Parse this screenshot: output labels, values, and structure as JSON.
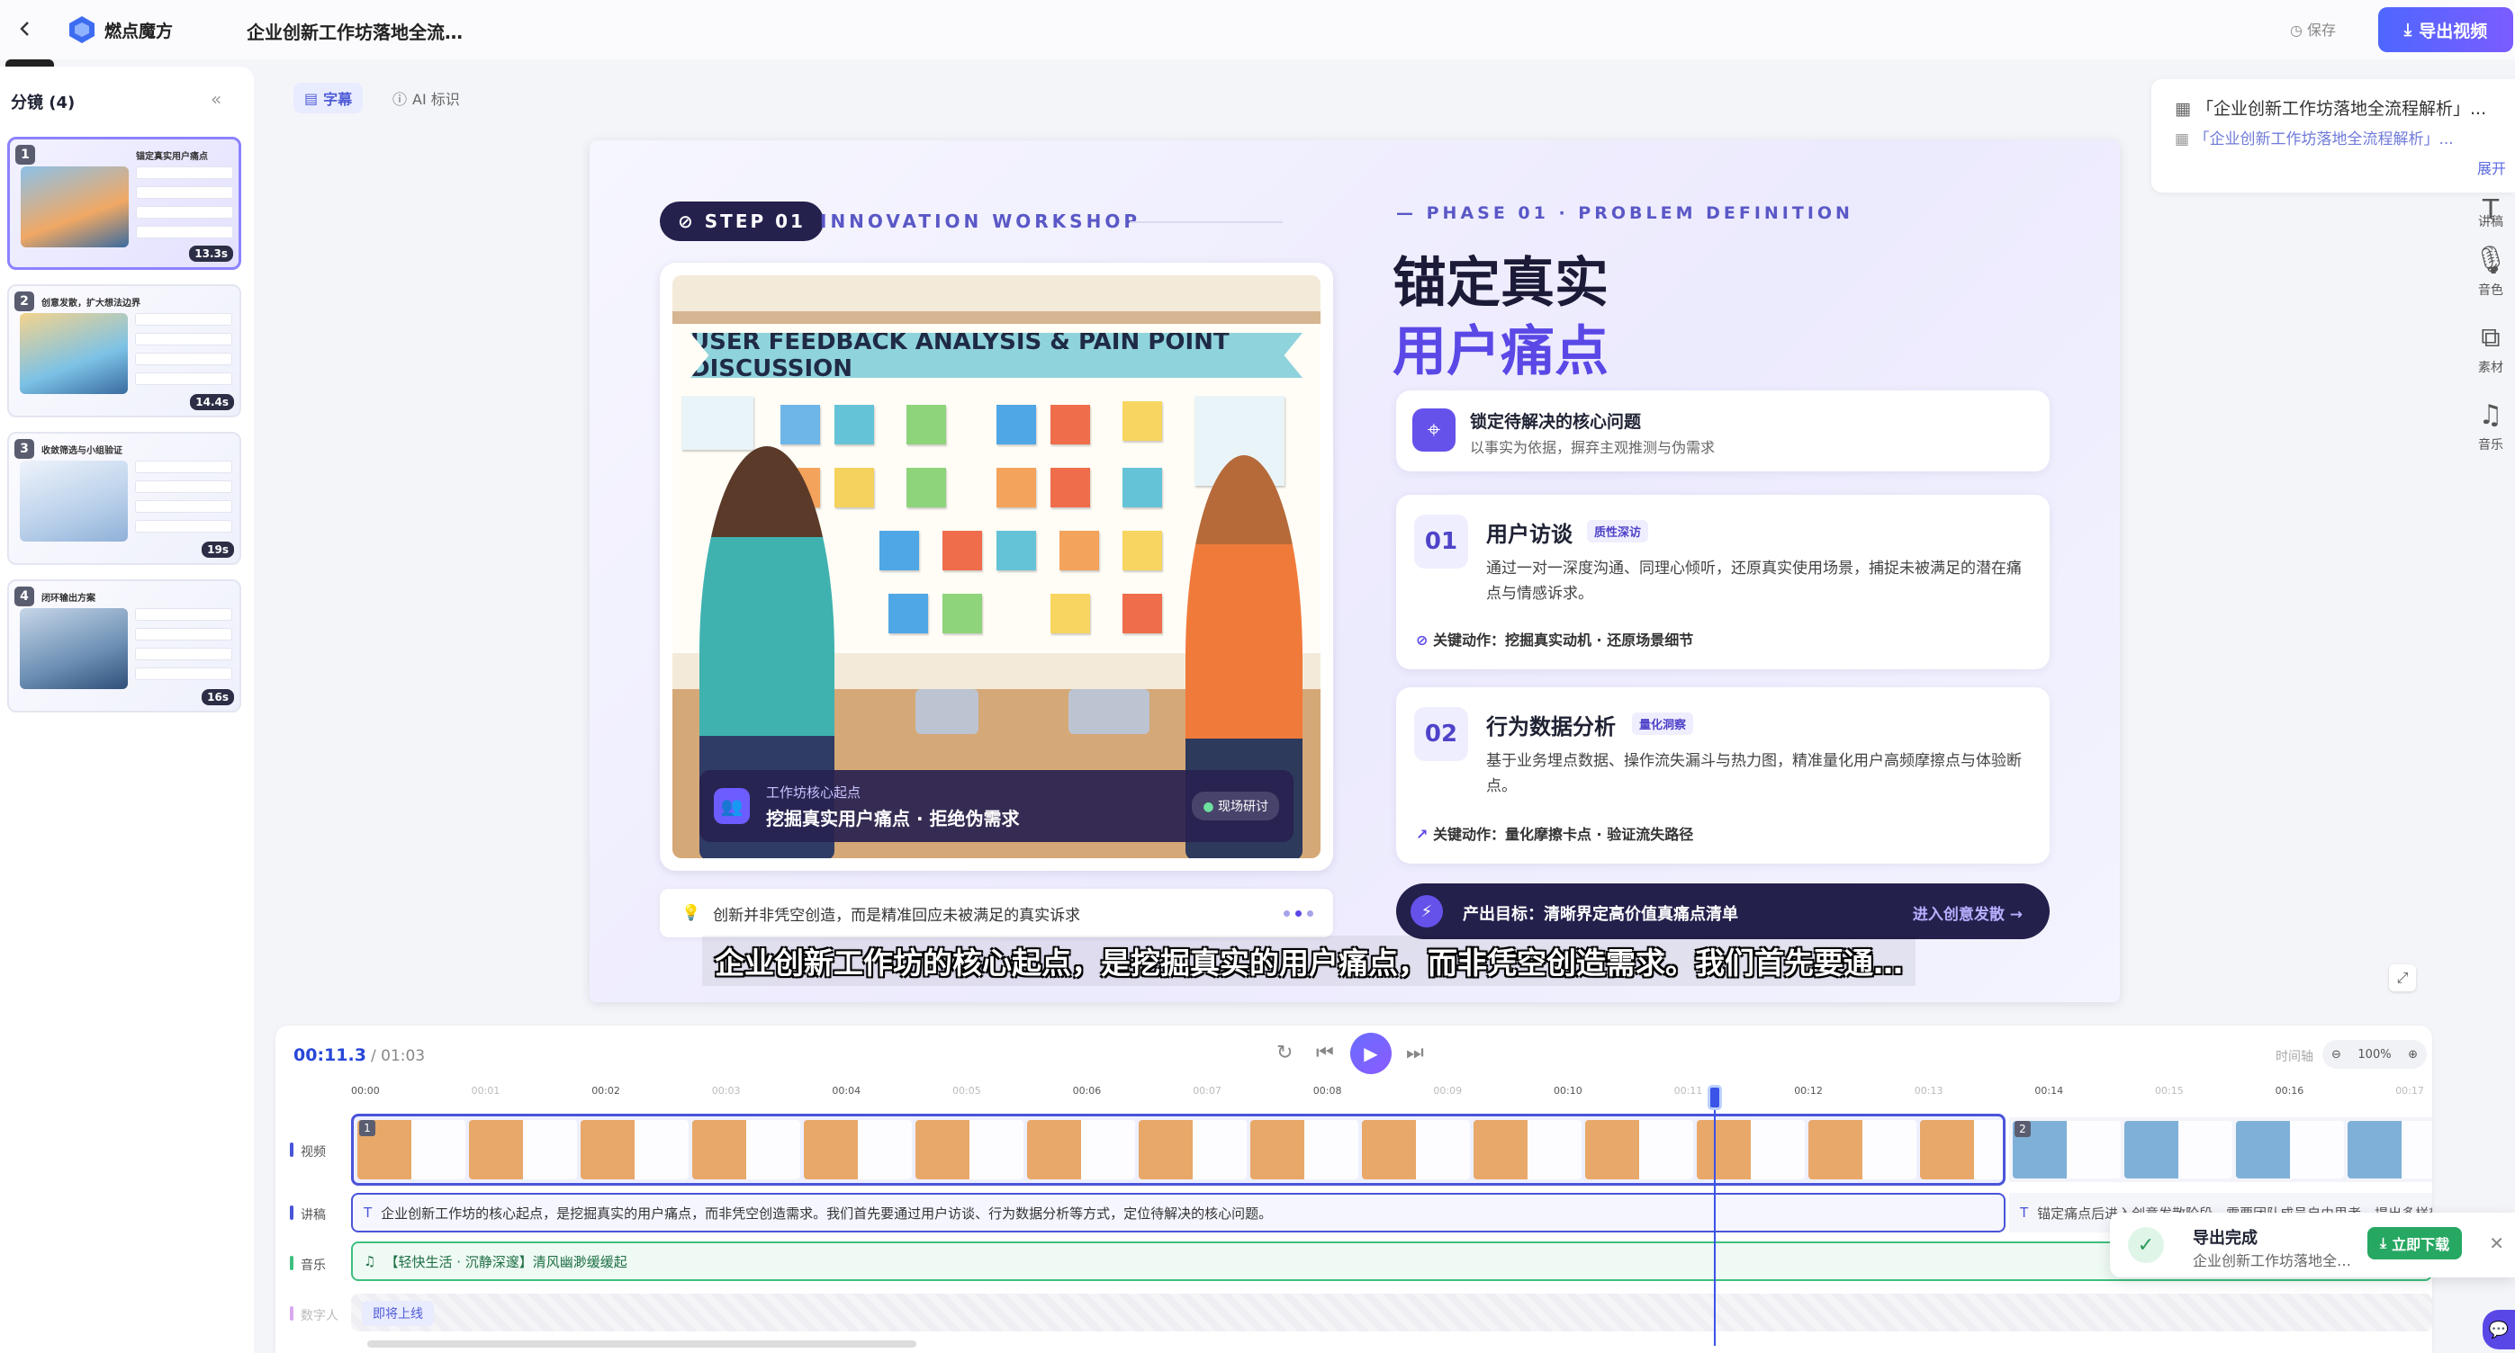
{
  "app": {
    "brand": "燃点魔方",
    "doc_title": "企业创新工作坊落地全流…",
    "back_tooltip": "返回",
    "save_label": "保存",
    "export_label": "导出视频"
  },
  "left_panel": {
    "title": "分镜 (4)",
    "scenes": [
      {
        "num": "1",
        "title": "锚定真实用户痛点",
        "duration": "13.3s",
        "active": true
      },
      {
        "num": "2",
        "title": "创意发散，扩大想法边界",
        "duration": "14.4s",
        "active": false
      },
      {
        "num": "3",
        "title": "收敛筛选与小组验证",
        "duration": "19s",
        "active": false
      },
      {
        "num": "4",
        "title": "闭环输出方案",
        "duration": "16s",
        "active": false
      }
    ]
  },
  "toolbar": {
    "subtitle_label": "字幕",
    "ai_label": "AI 标识"
  },
  "slide": {
    "step_pill": "STEP 01",
    "step_label": "INNOVATION WORKSHOP",
    "banner": "USER FEEDBACK ANALYSIS & PAIN POINT DISCUSSION",
    "caption_small": "工作坊核心起点",
    "caption_big": "挖掘真实用户痛点 · 拒绝伪需求",
    "caption_tag": "现场研讨",
    "quote": "创新并非凭空创造，而是精准回应未被满足的真实诉求",
    "phase": "— PHASE 01 · PROBLEM DEFINITION",
    "heading_line1": "锚定真实",
    "heading_line2": "用户痛点",
    "card1_title": "锁定待解决的核心问题",
    "card1_sub": "以事实为依据，摒弃主观推测与伪需求",
    "card2_num": "01",
    "card2_title": "用户访谈",
    "card2_tag": "质性深访",
    "card2_desc": "通过一对一深度沟通、同理心倾听，还原真实使用场景，捕捉未被满足的潜在痛点与情感诉求。",
    "card2_action": "关键动作：挖掘真实动机 · 还原场景细节",
    "card3_num": "02",
    "card3_title": "行为数据分析",
    "card3_tag": "量化洞察",
    "card3_desc": "基于业务埋点数据、操作流失漏斗与热力图，精准量化用户高频摩擦点与体验断点。",
    "card3_action": "关键动作：量化摩擦卡点 · 验证流失路径",
    "goal_text": "产出目标：清晰界定高价值真痛点清单",
    "goal_action": "进入创意发散 →"
  },
  "subtitle_overlay": "企业创新工作坊的核心起点，是挖掘真实的用户痛点，而非凭空创造需求。我们首先要通…",
  "right_panel": {
    "line1": "「企业创新工作坊落地全流程解析」...",
    "line2": "「企业创新工作坊落地全流程解析」...",
    "more": "展开",
    "tools": [
      {
        "icon": "T",
        "label": "讲稿"
      },
      {
        "icon": "🎙",
        "label": "音色"
      },
      {
        "icon": "◇",
        "label": "素材"
      },
      {
        "icon": "♫",
        "label": "音乐"
      }
    ]
  },
  "timeline": {
    "current_time": "00:11.3",
    "total_time": "/ 01:03",
    "zoom_label": "时间轴",
    "zoom_value": "100%",
    "ticks": [
      "00:00",
      "00:01",
      "00:02",
      "00:03",
      "00:04",
      "00:05",
      "00:06",
      "00:07",
      "00:08",
      "00:09",
      "00:10",
      "00:11",
      "00:12",
      "00:13",
      "00:14",
      "00:15",
      "00:16",
      "00:17"
    ],
    "track_labels": {
      "video": "视频",
      "narration": "讲稿",
      "music": "音乐",
      "avatar": "数字人"
    },
    "track_colors": {
      "video": "#4a54d9",
      "narration": "#4a54d9",
      "music": "#3fbf7f",
      "avatar": "#d9a8ef"
    },
    "narration_1": "企业创新工作坊的核心起点，是挖掘真实的用户痛点，而非凭空创造需求。我们首先要通过用户访谈、行为数据分析等方式，定位待解决的核心问题。",
    "narration_2": "锚定痛点后进入创意发散阶段，需要团队成员自由思考，提出多样想法",
    "music": "【轻快生活 · 沉静深邃】清风幽渺缓缓起",
    "avatar_btn": "即将上线",
    "segment_1": "1",
    "segment_2": "2"
  },
  "toast": {
    "title": "导出完成",
    "sub": "企业创新工作坊落地全…",
    "download": "立即下载"
  }
}
